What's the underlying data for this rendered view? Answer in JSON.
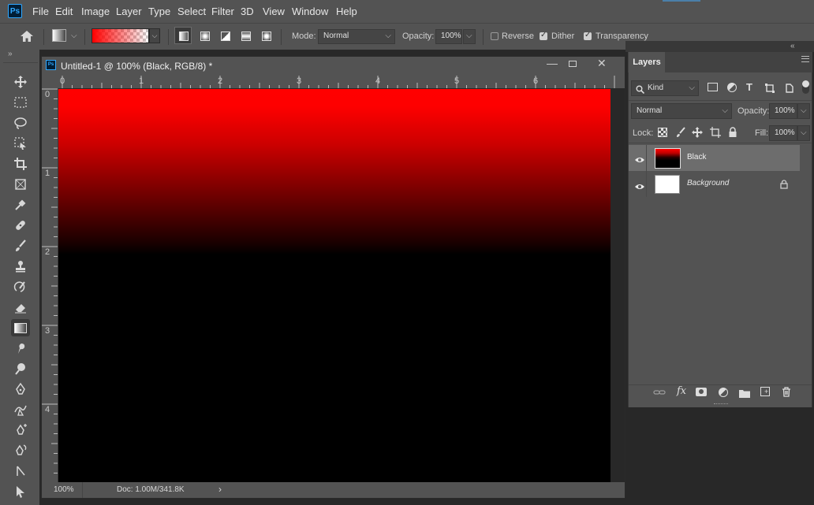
{
  "app": {
    "logo": "Ps"
  },
  "menu": [
    "File",
    "Edit",
    "Image",
    "Layer",
    "Type",
    "Select",
    "Filter",
    "3D",
    "View",
    "Window",
    "Help"
  ],
  "options": {
    "mode_label": "Mode:",
    "mode_value": "Normal",
    "opacity_label": "Opacity:",
    "opacity_value": "100%",
    "reverse_label": "Reverse",
    "reverse_checked": false,
    "dither_label": "Dither",
    "dither_checked": true,
    "transparency_label": "Transparency",
    "transparency_checked": true,
    "gradient_color": "#ff0000"
  },
  "tools": [
    "move-tool",
    "marquee-tool",
    "lasso-tool",
    "object-select-tool",
    "crop-tool",
    "frame-tool",
    "eyedropper-tool",
    "healing-brush-tool",
    "brush-tool",
    "clone-stamp-tool",
    "history-brush-tool",
    "eraser-tool",
    "gradient-tool",
    "smudge-tool",
    "dodge-tool",
    "pen-tool",
    "freeform-pen-tool",
    "curvature-pen-tool",
    "add-anchor-tool",
    "path-select-tool",
    "direct-select-tool"
  ],
  "document": {
    "title": "Untitled-1 @ 100% (Black, RGB/8) *",
    "ruler_h": [
      "0",
      "1",
      "2",
      "3",
      "4",
      "5",
      "6"
    ],
    "ruler_v": [
      "0",
      "1",
      "2",
      "3",
      "4"
    ],
    "zoom": "100%",
    "doc_info": "Doc: 1.00M/341.8K"
  },
  "layers_panel": {
    "tab_label": "Layers",
    "filter_kind": "Kind",
    "blend_mode": "Normal",
    "opacity_label": "Opacity:",
    "opacity_value": "100%",
    "lock_label": "Lock:",
    "fill_label": "Fill:",
    "fill_value": "100%",
    "layers": [
      {
        "name": "Black",
        "visible": true,
        "selected": true
      },
      {
        "name": "Background",
        "visible": true,
        "selected": false,
        "locked": true
      }
    ]
  },
  "colors": {
    "accent_red": "#ff0000",
    "canvas_bottom": "#000000",
    "background_thumb": "#ffffff"
  }
}
